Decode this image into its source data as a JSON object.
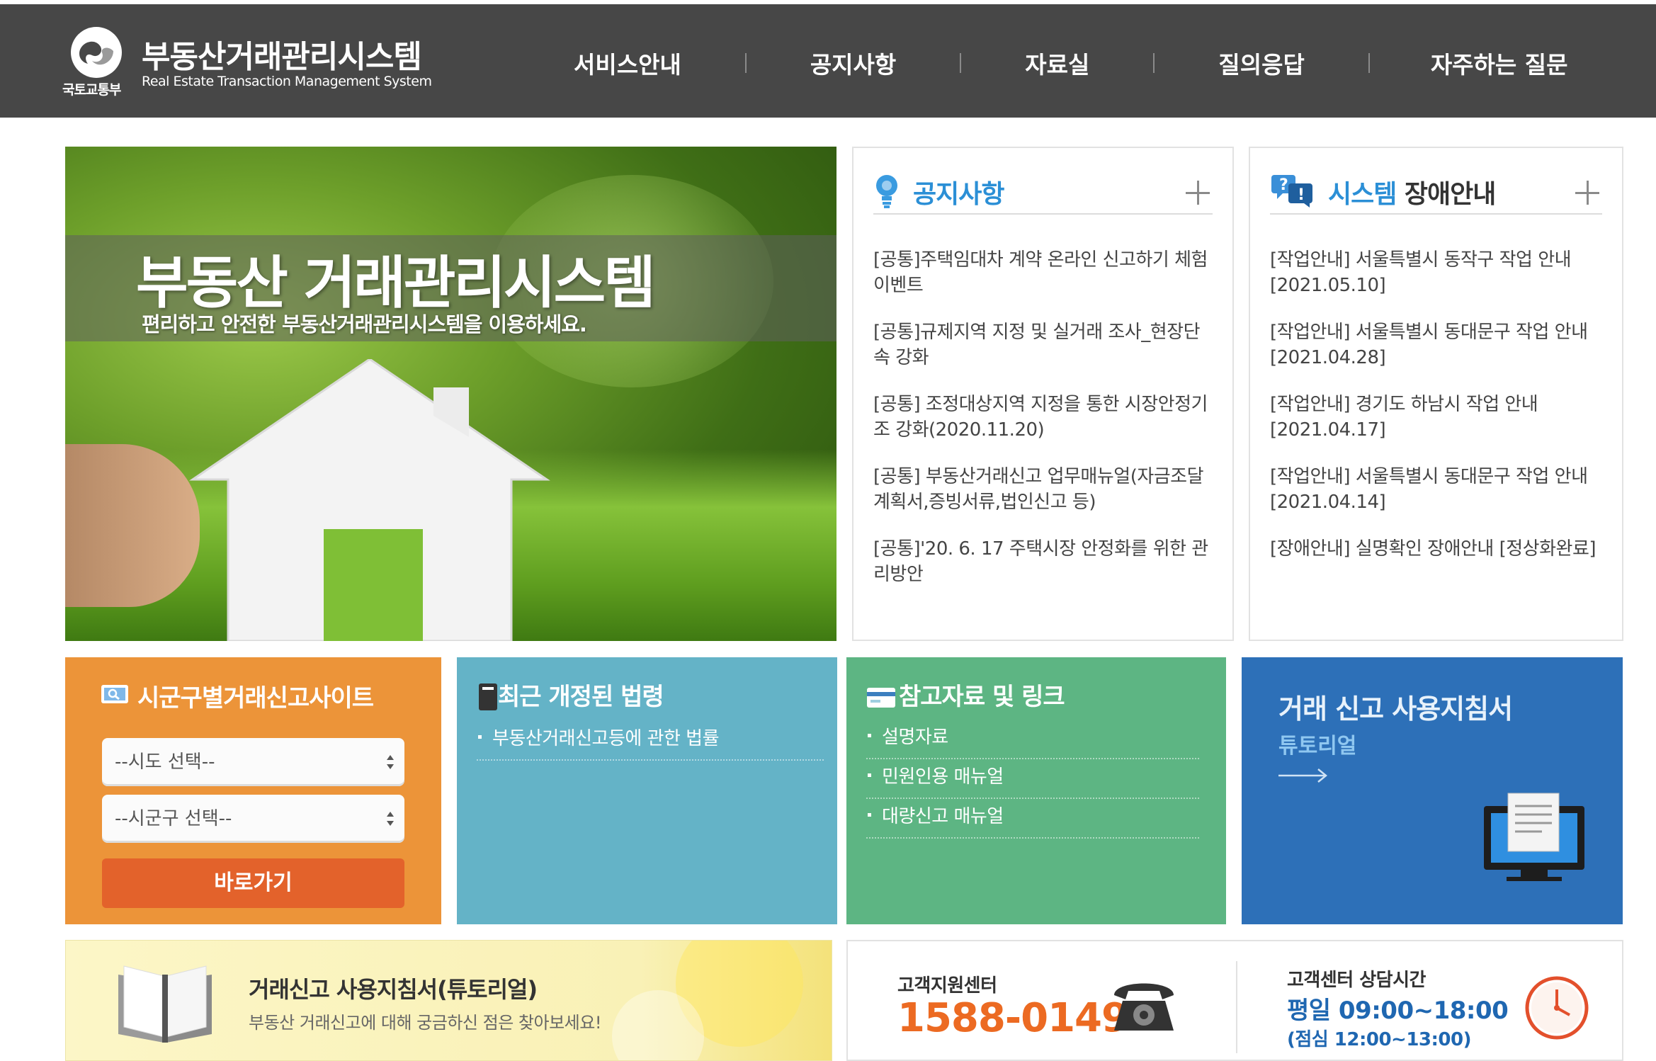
{
  "header": {
    "ministry": "국토교통부",
    "title": "부동산거래관리시스템",
    "subtitle": "Real Estate Transaction Management System",
    "nav": [
      "서비스안내",
      "공지사항",
      "자료실",
      "질의응답",
      "자주하는 질문"
    ]
  },
  "hero": {
    "title": "부동산 거래관리시스템",
    "subtitle": "편리하고 안전한 부동산거래관리시스템을 이용하세요."
  },
  "notice": {
    "title": "공지사항",
    "items": [
      "[공통]주택임대차 계약 온라인 신고하기 체험 이벤트",
      "[공통]규제지역 지정 및 실거래 조사_현장단속 강화",
      "[공통] 조정대상지역 지정을 통한 시장안정기조 강화(2020.11.20)",
      "[공통] 부동산거래신고 업무매뉴얼(자금조달계획서,증빙서류,법인신고 등)",
      "[공통]'20. 6. 17 주택시장 안정화를 위한 관리방안"
    ]
  },
  "fault": {
    "title_a": "시스템",
    "title_b": " 장애안내",
    "items": [
      "[작업안내] 서울특별시 동작구 작업 안내 [2021.05.10]",
      "[작업안내] 서울특별시 동대문구 작업 안내 [2021.04.28]",
      "[작업안내] 경기도 하남시 작업 안내 [2021.04.17]",
      "[작업안내] 서울특별시 동대문구 작업 안내 [2021.04.14]",
      "[장애안내] 실명확인 장애안내 [정상화완료]"
    ]
  },
  "site_select": {
    "title": "시군구별거래신고사이트",
    "sido": "--시도 선택--",
    "sigungu": "--시군구 선택--",
    "go": "바로가기"
  },
  "laws": {
    "title": "최근 개정된 법령",
    "items": [
      "부동산거래신고등에 관한 법률"
    ]
  },
  "refs": {
    "title": "참고자료 및 링크",
    "items": [
      "설명자료",
      "민원인용 매뉴얼",
      "대량신고 매뉴얼"
    ]
  },
  "guide": {
    "title": "거래 신고 사용지침서",
    "sub": "튜토리얼"
  },
  "banner": {
    "title": "거래신고 사용지침서(튜토리얼)",
    "sub": "부동산 거래신고에 대해 궁금하신 점은 찾아보세요!"
  },
  "support": {
    "label": "고객지원센터",
    "phone": "1588-0149",
    "hours_label": "고객센터 상담시간",
    "hours": "평일 09:00~18:00",
    "lunch": "(점심 12:00~13:00)"
  },
  "colors": {
    "header_bg": "#474747",
    "notice_blue": "#2b8fd6",
    "tile_orange": "#ec9439",
    "tile_teal": "#64b3c7",
    "tile_green": "#5db583",
    "tile_blue": "#2d70b8",
    "phone_orange": "#ec6a22"
  }
}
